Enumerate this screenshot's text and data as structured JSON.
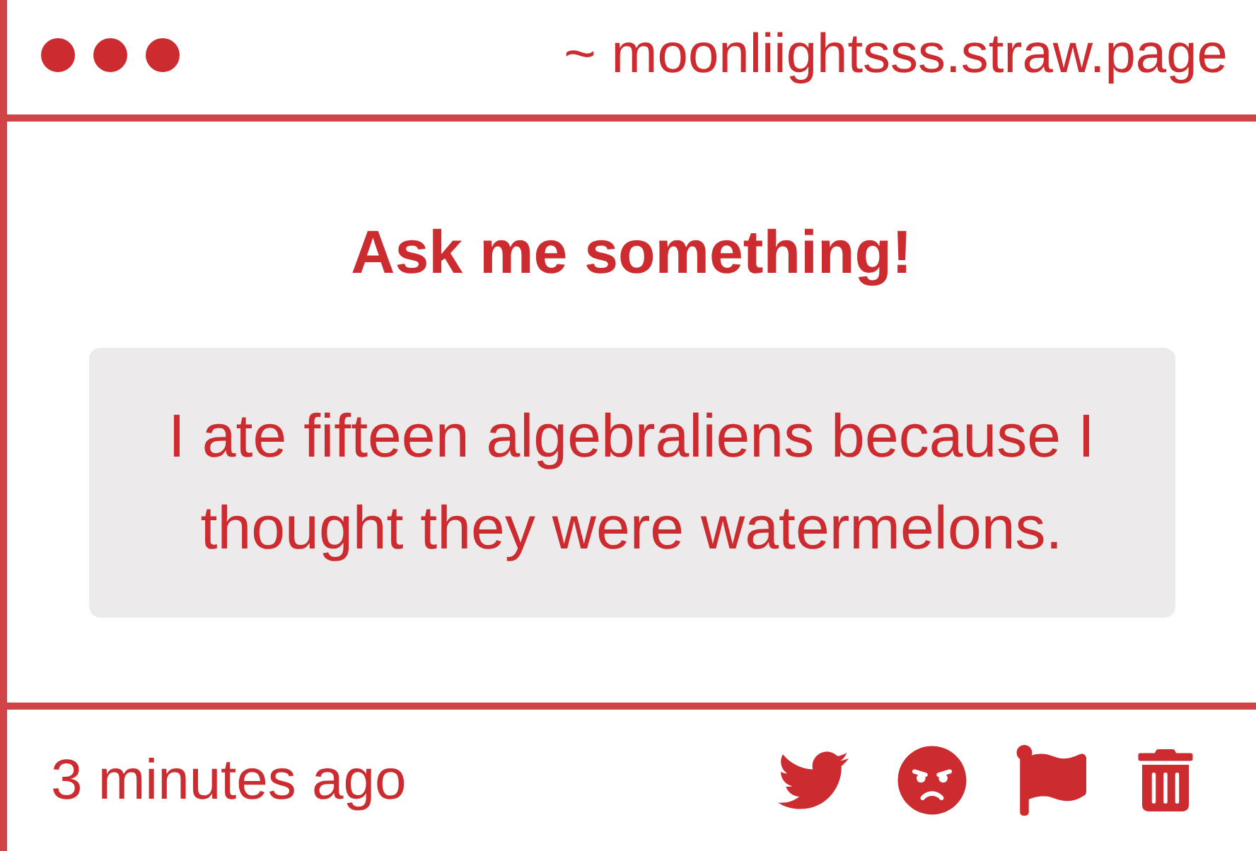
{
  "header": {
    "url": "~ moonliightsss.straw.page"
  },
  "prompt": {
    "title": "Ask me something!"
  },
  "answer": {
    "text": "I ate fifteen algebraliens because I thought they were watermelons."
  },
  "footer": {
    "time": "3 minutes ago",
    "actions": [
      {
        "kind": "twitter"
      },
      {
        "kind": "angry"
      },
      {
        "kind": "flag"
      },
      {
        "kind": "trash"
      }
    ]
  }
}
